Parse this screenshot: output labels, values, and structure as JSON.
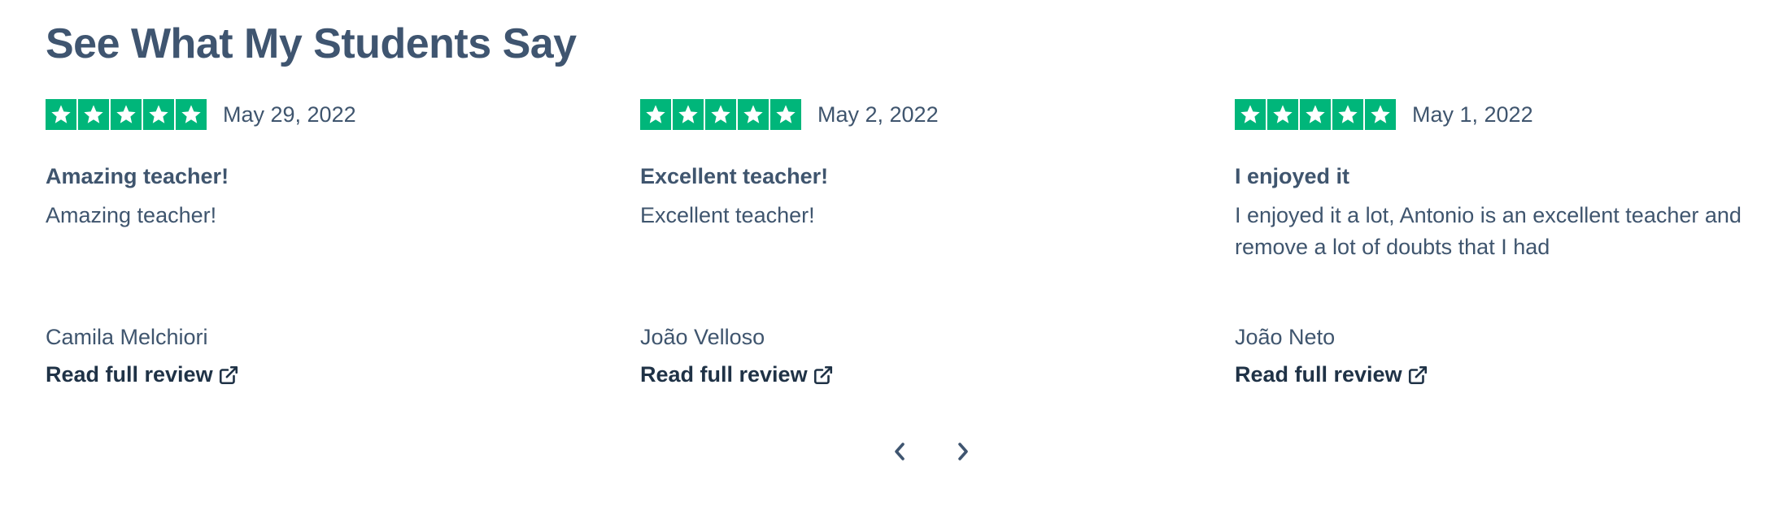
{
  "section": {
    "title": "See What My Students Say"
  },
  "colors": {
    "accent": "#00b67a",
    "text": "#3f556e",
    "link": "#1f3246"
  },
  "reviews": [
    {
      "rating": 5,
      "date": "May 29, 2022",
      "title": "Amazing teacher!",
      "body": "Amazing teacher!",
      "author": "Camila Melchiori",
      "link_label": "Read full review",
      "link_icon": "external-link-icon"
    },
    {
      "rating": 5,
      "date": "May 2, 2022",
      "title": "Excellent teacher!",
      "body": "Excellent teacher!",
      "author": "João Velloso",
      "link_label": "Read full review",
      "link_icon": "external-link-icon"
    },
    {
      "rating": 5,
      "date": "May 1, 2022",
      "title": "I enjoyed it",
      "body": "I enjoyed it a lot, Antonio is an excellent teacher and remove a lot of doubts that I had",
      "author": "João Neto",
      "link_label": "Read full review",
      "link_icon": "external-link-icon"
    }
  ],
  "carousel": {
    "prev_icon": "chevron-left-icon",
    "next_icon": "chevron-right-icon"
  }
}
